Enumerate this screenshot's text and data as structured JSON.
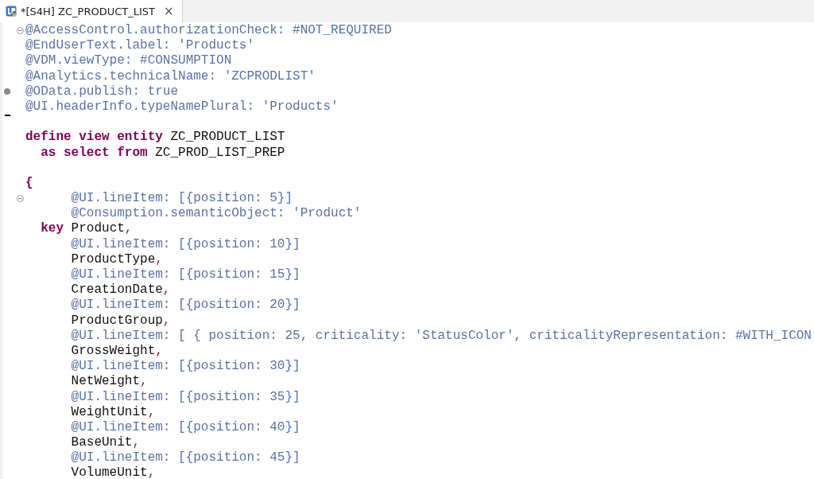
{
  "tab": {
    "title": "*[S4H] ZC_PRODUCT_LIST",
    "close": "×",
    "selected": true
  },
  "lines": [
    {
      "kind": "fold",
      "expanded": true,
      "segments": [
        {
          "kind": "annotation",
          "text": "@AccessControl.authorizationCheck: #NOT_REQUIRED"
        }
      ]
    },
    {
      "segments": [
        {
          "kind": "annotation",
          "text": "@EndUserText.label: 'Products'"
        }
      ]
    },
    {
      "segments": [
        {
          "kind": "annotation",
          "text": "@VDM.viewType: #CONSUMPTION"
        }
      ]
    },
    {
      "segments": [
        {
          "kind": "annotation",
          "text": "@Analytics.technicalName: 'ZCPRODLIST'"
        }
      ]
    },
    {
      "kind": "dot",
      "segments": [
        {
          "kind": "annotation",
          "text": "@OData.publish: true"
        }
      ]
    },
    {
      "segments": [
        {
          "kind": "annotation",
          "text": "@UI.headerInfo.typeNamePlural: 'Products'"
        }
      ]
    },
    {
      "kind": "dash"
    },
    {
      "segments": [
        {
          "kind": "keyword",
          "text": "define view entity"
        },
        {
          "kind": "plain",
          "text": " ZC_PRODUCT_LIST"
        }
      ]
    },
    {
      "segments": [
        {
          "kind": "keyword",
          "text": "  as select from"
        },
        {
          "kind": "plain",
          "text": " ZC_PROD_LIST_PREP"
        }
      ]
    },
    {
      "kind": "blank"
    },
    {
      "segments": [
        {
          "kind": "keyword",
          "text": "{"
        }
      ]
    },
    {
      "kind": "fold",
      "expanded": true,
      "segments": [
        {
          "kind": "annotation",
          "text": "      @UI.lineItem: [{position: 5}]"
        }
      ]
    },
    {
      "segments": [
        {
          "kind": "annotation",
          "text": "      @Consumption.semanticObject: 'Product'"
        }
      ]
    },
    {
      "segments": [
        {
          "kind": "keyword",
          "text": "  key"
        },
        {
          "kind": "plain",
          "text": " Product"
        },
        {
          "kind": "punct",
          "text": ","
        }
      ]
    },
    {
      "segments": [
        {
          "kind": "annotation",
          "text": "      @UI.lineItem: [{position: 10}]"
        }
      ]
    },
    {
      "segments": [
        {
          "kind": "plain",
          "text": "      ProductType"
        },
        {
          "kind": "punct",
          "text": ","
        }
      ]
    },
    {
      "segments": [
        {
          "kind": "annotation",
          "text": "      @UI.lineItem: [{position: 15}]"
        }
      ]
    },
    {
      "segments": [
        {
          "kind": "plain",
          "text": "      CreationDate"
        },
        {
          "kind": "punct",
          "text": ","
        }
      ]
    },
    {
      "segments": [
        {
          "kind": "annotation",
          "text": "      @UI.lineItem: [{position: 20}]"
        }
      ]
    },
    {
      "segments": [
        {
          "kind": "plain",
          "text": "      ProductGroup"
        },
        {
          "kind": "punct",
          "text": ","
        }
      ]
    },
    {
      "segments": [
        {
          "kind": "annotation",
          "text": "      @UI.lineItem: [ { position: 25, criticality: 'StatusColor', criticalityRepresentation: #WITH_ICON"
        }
      ]
    },
    {
      "segments": [
        {
          "kind": "plain",
          "text": "      GrossWeight"
        },
        {
          "kind": "punct",
          "text": ","
        }
      ]
    },
    {
      "segments": [
        {
          "kind": "annotation",
          "text": "      @UI.lineItem: [{position: 30}]"
        }
      ]
    },
    {
      "segments": [
        {
          "kind": "plain",
          "text": "      NetWeight"
        },
        {
          "kind": "punct",
          "text": ","
        }
      ]
    },
    {
      "segments": [
        {
          "kind": "annotation",
          "text": "      @UI.lineItem: [{position: 35}]"
        }
      ]
    },
    {
      "segments": [
        {
          "kind": "plain",
          "text": "      WeightUnit"
        },
        {
          "kind": "punct",
          "text": ","
        }
      ]
    },
    {
      "segments": [
        {
          "kind": "annotation",
          "text": "      @UI.lineItem: [{position: 40}]"
        }
      ]
    },
    {
      "segments": [
        {
          "kind": "plain",
          "text": "      BaseUnit"
        },
        {
          "kind": "punct",
          "text": ","
        }
      ]
    },
    {
      "segments": [
        {
          "kind": "annotation",
          "text": "      @UI.lineItem: [{position: 45}]"
        }
      ]
    },
    {
      "segments": [
        {
          "kind": "plain",
          "text": "      VolumeUnit"
        },
        {
          "kind": "punct",
          "text": ","
        }
      ]
    }
  ]
}
